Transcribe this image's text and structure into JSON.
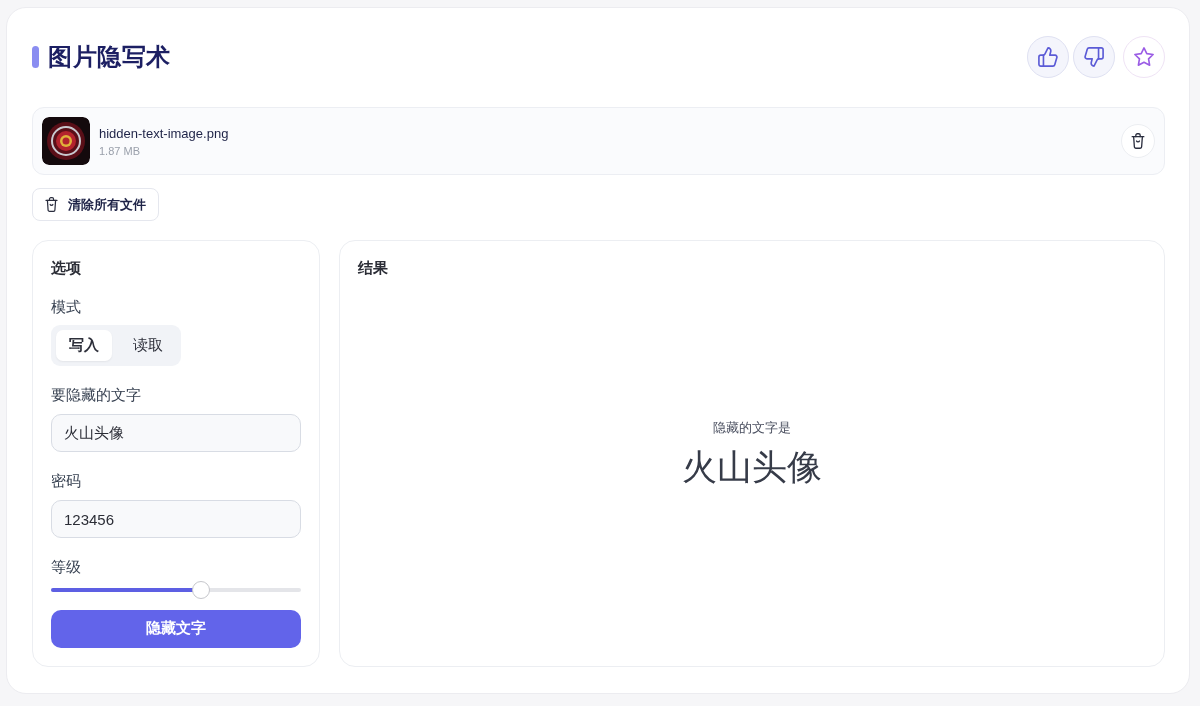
{
  "header": {
    "title": "图片隐写术"
  },
  "files": [
    {
      "name": "hidden-text-image.png",
      "size": "1.87 MB"
    }
  ],
  "clear_button": {
    "label": "清除所有文件"
  },
  "options": {
    "title": "选项",
    "mode": {
      "label": "模式",
      "options": [
        {
          "label": "写入",
          "selected": true
        },
        {
          "label": "读取",
          "selected": false
        }
      ]
    },
    "fields": [
      {
        "label": "要隐藏的文字",
        "value": "火山头像"
      },
      {
        "label": "密码",
        "value": "123456"
      }
    ],
    "strength": {
      "label": "等级",
      "level": 0.6
    },
    "submit": {
      "label": "隐藏文字"
    }
  },
  "result": {
    "title": "结果",
    "caption": "隐藏的文字是",
    "text": "火山头像"
  }
}
